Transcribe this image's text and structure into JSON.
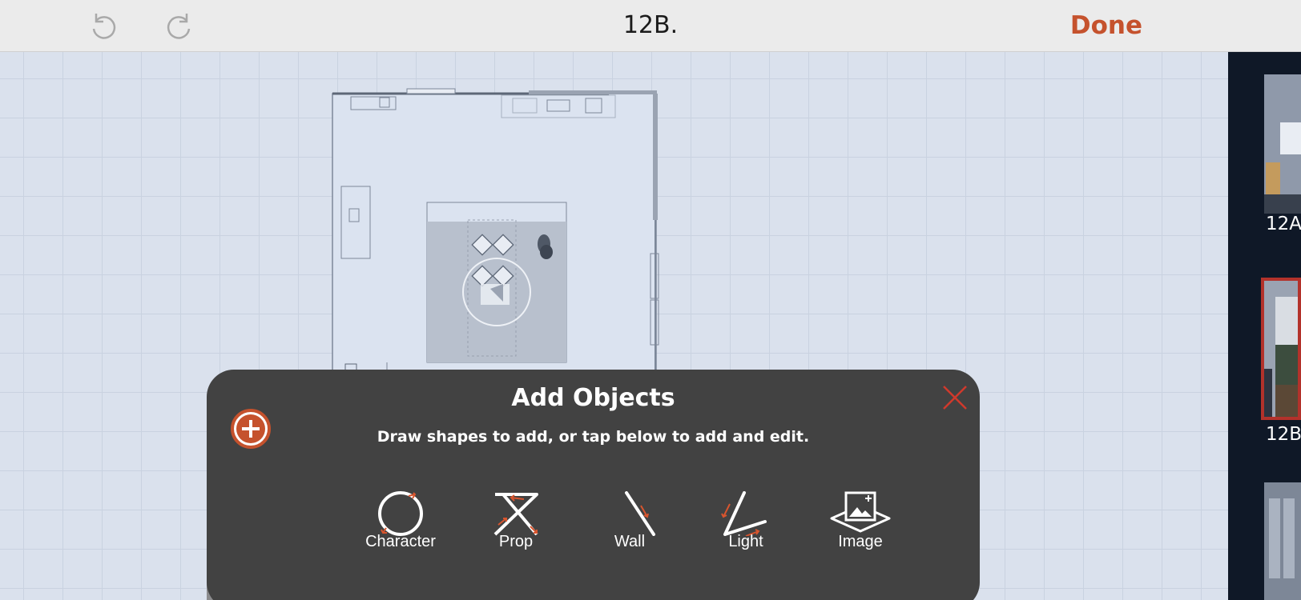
{
  "header": {
    "title": "12B.",
    "done_label": "Done",
    "undo_icon": "undo-icon",
    "redo_icon": "redo-icon"
  },
  "shots": [
    {
      "label": "12A",
      "selected": false
    },
    {
      "label": "12B",
      "selected": true
    },
    {
      "label": "",
      "selected": false
    }
  ],
  "panel": {
    "title": "Add Objects",
    "subtitle": "Draw shapes to add, or tap below to add and edit.",
    "tools": [
      {
        "label": "Character",
        "icon": "circle-gesture-icon"
      },
      {
        "label": "Prop",
        "icon": "cross-gesture-icon"
      },
      {
        "label": "Wall",
        "icon": "line-gesture-icon"
      },
      {
        "label": "Light",
        "icon": "angle-gesture-icon"
      },
      {
        "label": "Image",
        "icon": "image-add-icon"
      }
    ]
  },
  "colors": {
    "accent": "#c5522d",
    "panel": "#424242",
    "canvas": "#dae1ed",
    "strip": "#0f1827"
  }
}
